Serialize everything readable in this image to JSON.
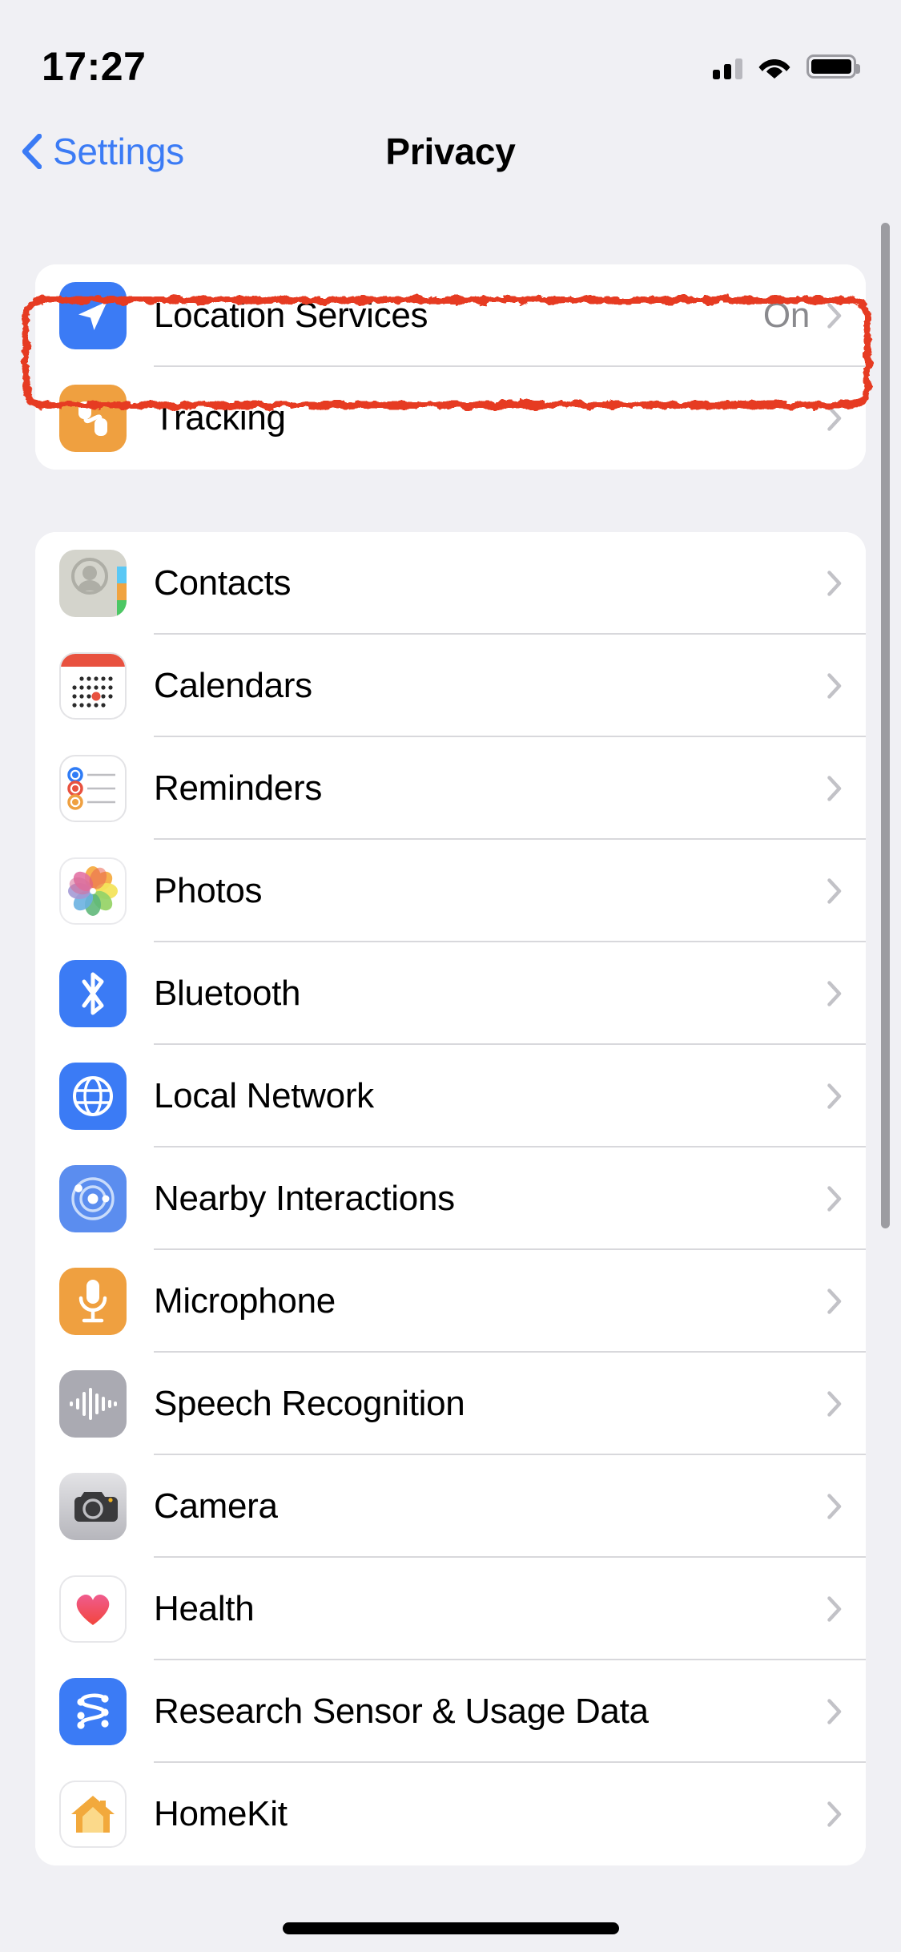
{
  "status_bar": {
    "time": "17:27",
    "cellular_icon": "cellular-signal-icon",
    "wifi_icon": "wifi-icon",
    "battery_icon": "battery-full-icon",
    "signal_bars_filled": 2,
    "signal_bars_total": 3
  },
  "nav": {
    "back_label": "Settings",
    "back_icon": "chevron-left-icon",
    "title": "Privacy"
  },
  "groups": [
    {
      "id": "top",
      "rows": [
        {
          "label": "Location Services",
          "value": "On",
          "icon": "location-arrow-icon",
          "icon_style": "ic-loc",
          "highlighted": true
        },
        {
          "label": "Tracking",
          "value": "",
          "icon": "tracking-icon",
          "icon_style": "ic-track",
          "highlighted": false
        }
      ]
    },
    {
      "id": "permissions",
      "rows": [
        {
          "label": "Contacts",
          "value": "",
          "icon": "contacts-icon",
          "icon_style": "ic-contacts",
          "highlighted": false
        },
        {
          "label": "Calendars",
          "value": "",
          "icon": "calendar-icon",
          "icon_style": "ic-cal",
          "highlighted": false
        },
        {
          "label": "Reminders",
          "value": "",
          "icon": "reminders-icon",
          "icon_style": "ic-rem",
          "highlighted": false
        },
        {
          "label": "Photos",
          "value": "",
          "icon": "photos-icon",
          "icon_style": "ic-photos",
          "highlighted": false
        },
        {
          "label": "Bluetooth",
          "value": "",
          "icon": "bluetooth-icon",
          "icon_style": "ic-bt",
          "highlighted": false
        },
        {
          "label": "Local Network",
          "value": "",
          "icon": "globe-icon",
          "icon_style": "ic-net",
          "highlighted": false
        },
        {
          "label": "Nearby Interactions",
          "value": "",
          "icon": "nearby-interactions-icon",
          "icon_style": "ic-near",
          "highlighted": false
        },
        {
          "label": "Microphone",
          "value": "",
          "icon": "microphone-icon",
          "icon_style": "ic-mic",
          "highlighted": false
        },
        {
          "label": "Speech Recognition",
          "value": "",
          "icon": "waveform-icon",
          "icon_style": "ic-speech",
          "highlighted": false
        },
        {
          "label": "Camera",
          "value": "",
          "icon": "camera-icon",
          "icon_style": "ic-cam",
          "highlighted": false
        },
        {
          "label": "Health",
          "value": "",
          "icon": "heart-icon",
          "icon_style": "ic-health",
          "highlighted": false
        },
        {
          "label": "Research Sensor & Usage Data",
          "value": "",
          "icon": "research-sensor-icon",
          "icon_style": "ic-res",
          "highlighted": false
        },
        {
          "label": "HomeKit",
          "value": "",
          "icon": "homekit-icon",
          "icon_style": "ic-home",
          "highlighted": false
        }
      ]
    }
  ],
  "annotation": {
    "target": "Location Services",
    "color": "#E63B20",
    "shape": "rounded-rectangle-outline"
  },
  "colors": {
    "accent_blue": "#3B7BF5",
    "page_background": "#F0F0F4",
    "card_background": "#FFFFFF",
    "secondary_text": "#8A8A8E",
    "separator": "#D8D8DC",
    "orange": "#EFA040",
    "annotation_red": "#E63B20"
  },
  "scrollbar": {
    "visible": true
  }
}
